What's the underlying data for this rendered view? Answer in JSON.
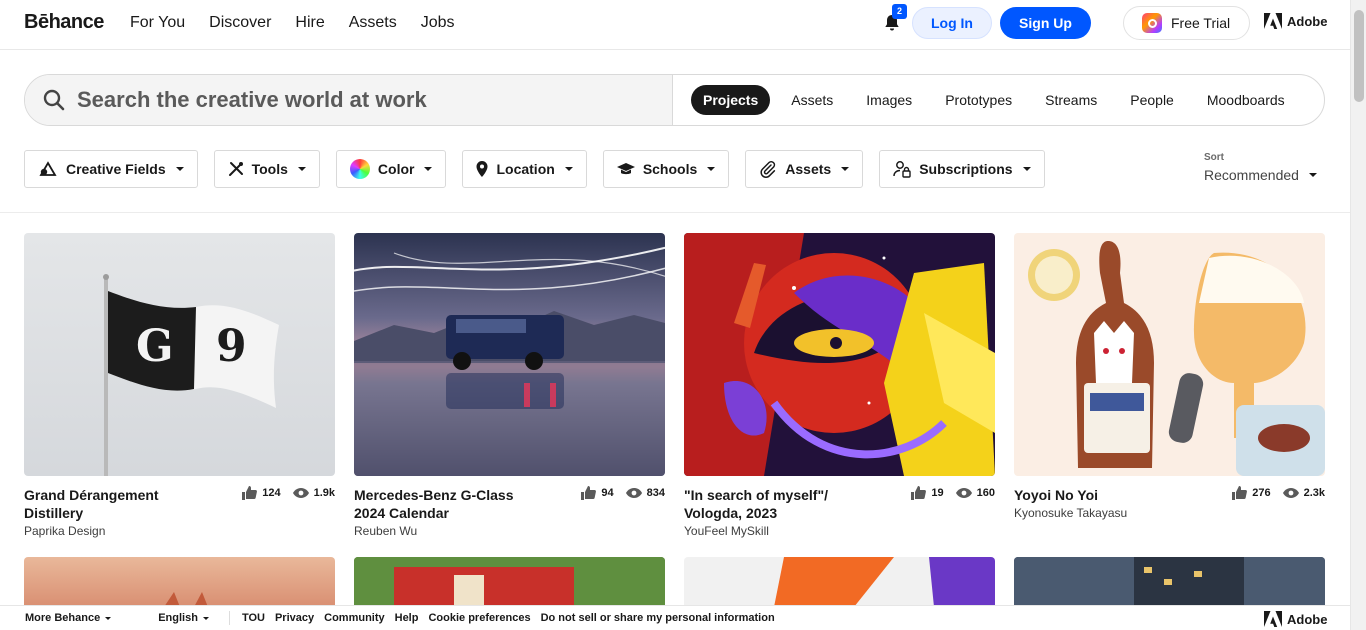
{
  "brand": {
    "logo": "Bēhance",
    "adobe": "Adobe"
  },
  "nav": {
    "links": [
      "For You",
      "Discover",
      "Hire",
      "Assets",
      "Jobs"
    ]
  },
  "header": {
    "notifications": "2",
    "login": "Log In",
    "signup": "Sign Up",
    "trial": "Free Trial"
  },
  "search": {
    "placeholder": "Search the creative world at work",
    "tabs": [
      "Projects",
      "Assets",
      "Images",
      "Prototypes",
      "Streams",
      "People",
      "Moodboards"
    ],
    "active_tab": "Projects"
  },
  "filters": [
    "Creative Fields",
    "Tools",
    "Color",
    "Location",
    "Schools",
    "Assets",
    "Subscriptions"
  ],
  "sort": {
    "label": "Sort",
    "value": "Recommended"
  },
  "projects": [
    {
      "title": "Grand Dérangement Distillery",
      "owner": "Paprika Design",
      "likes": "124",
      "views": "1.9k"
    },
    {
      "title": "Mercedes-Benz G-Class 2024 Calendar",
      "owner": "Reuben Wu",
      "likes": "94",
      "views": "834"
    },
    {
      "title": "\"In search of myself\"/ Vologda, 2023",
      "owner": "YouFeel MySkill",
      "likes": "19",
      "views": "160"
    },
    {
      "title": "Yoyoi No Yoi",
      "owner": "Kyonosuke Takayasu",
      "likes": "276",
      "views": "2.3k"
    }
  ],
  "footer": {
    "more": "More Behance",
    "language": "English",
    "links": [
      "TOU",
      "Privacy",
      "Community",
      "Help",
      "Cookie preferences",
      "Do not sell or share my personal information"
    ]
  }
}
